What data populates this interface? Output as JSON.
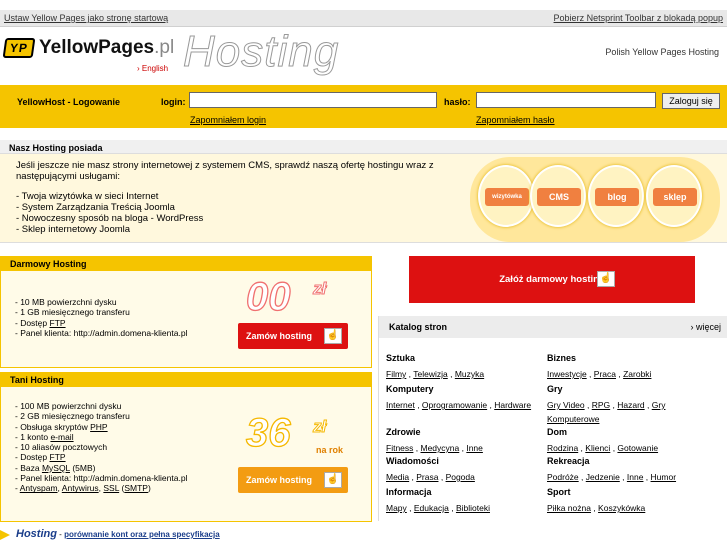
{
  "topbar": {
    "left_link": "Ustaw Yellow Pages jako stronę startową",
    "right_link": "Pobierz Netsprint Toolbar z blokadą popup"
  },
  "logo": {
    "mark": "YP",
    "name": "YellowPages",
    "suffix": ".pl"
  },
  "header": {
    "english": "› English",
    "hosting": "Hosting",
    "tagline": "Polish Yellow Pages Hosting"
  },
  "login": {
    "title": "YellowHost - Logowanie",
    "login_label": "login:",
    "password_label": "hasło:",
    "submit": "Zaloguj się",
    "forgot_login": "Zapomniałem login",
    "forgot_password": "Zapomniałem hasło"
  },
  "ours": {
    "heading": "Nasz Hosting posiada",
    "intro": "Jeśli jeszcze nie masz strony internetowej z systemem CMS, sprawdź naszą ofertę hostingu wraz z następującymi usługami:",
    "items": [
      "- Twoja wizytówka w sieci Internet",
      "- System Zarządzania Treścią Joomla",
      "- Nowoczesny sposób na bloga - WordPress",
      "- Sklep internetowy Joomla"
    ],
    "bubbles": [
      "wizytówka",
      "CMS",
      "blog",
      "sklep"
    ]
  },
  "free": {
    "heading": "Darmowy Hosting",
    "items": [
      "- 10 MB powierzchni dysku",
      "- 1 GB miesięcznego transferu",
      "- Dostęp ",
      "- Panel klienta: http://admin.domena-klienta.pl"
    ],
    "ftp": "FTP",
    "price": "00",
    "currency": "zł",
    "button": "Zamów hosting",
    "accent": "#d11"
  },
  "cheap": {
    "heading": "Tani Hosting",
    "items": [
      "- 100 MB powierzchni dysku",
      "- 2 GB miesięcznego transferu",
      "- Obsługa skryptów ",
      "- 1 konto ",
      "- 10 aliasów pocztowych",
      "- Dostęp ",
      "- Baza ",
      "- Panel klienta: http://admin.domena-klienta.pl",
      "- "
    ],
    "php": "PHP",
    "email": "e-mail",
    "ftp": "FTP",
    "mysql": "MySQL",
    "mysql_note": " (5MB)",
    "antyspam": "Antyspam",
    "antywirus": "Antywirus",
    "ssl": "SSL",
    "smtp": "SMTP",
    "price": "36",
    "currency": "zł",
    "period": "na rok",
    "button": "Zamów hosting",
    "accent": "#f39c12"
  },
  "big_button": "Załóż darmowy hosting",
  "katalog": {
    "heading": "Katalog stron",
    "more": "› więcej",
    "left": [
      {
        "title": "Sztuka",
        "links": [
          "Filmy",
          "Telewizja",
          "Muzyka"
        ]
      },
      {
        "title": "Komputery",
        "links": [
          "Internet",
          "Oprogramowanie",
          "Hardware"
        ]
      },
      {
        "title": "Zdrowie",
        "links": [
          "Fitness",
          "Medycyna",
          "Inne"
        ]
      },
      {
        "title": "Wiadomości",
        "links": [
          "Media",
          "Prasa",
          "Pogoda"
        ]
      },
      {
        "title": "Informacja",
        "links": [
          "Mapy",
          "Edukacja",
          "Biblioteki"
        ]
      }
    ],
    "right": [
      {
        "title": "Biznes",
        "links": [
          "Inwestycje",
          "Praca",
          "Zarobki"
        ]
      },
      {
        "title": "Gry",
        "links": [
          "Gry Video",
          "RPG",
          "Hazard",
          "Gry Komputerowe"
        ]
      },
      {
        "title": "Dom",
        "links": [
          "Rodzina",
          "Klienci",
          "Gotowanie"
        ]
      },
      {
        "title": "Rekreacja",
        "links": [
          "Podróże",
          "Jedzenie",
          "Inne",
          "Humor"
        ]
      },
      {
        "title": "Sport",
        "links": [
          "Piłka nożna",
          "Koszykówka"
        ]
      }
    ]
  },
  "footer": {
    "title": "Hosting",
    "link": "porównanie kont oraz pełna specyfikacja",
    "sep": " - "
  }
}
